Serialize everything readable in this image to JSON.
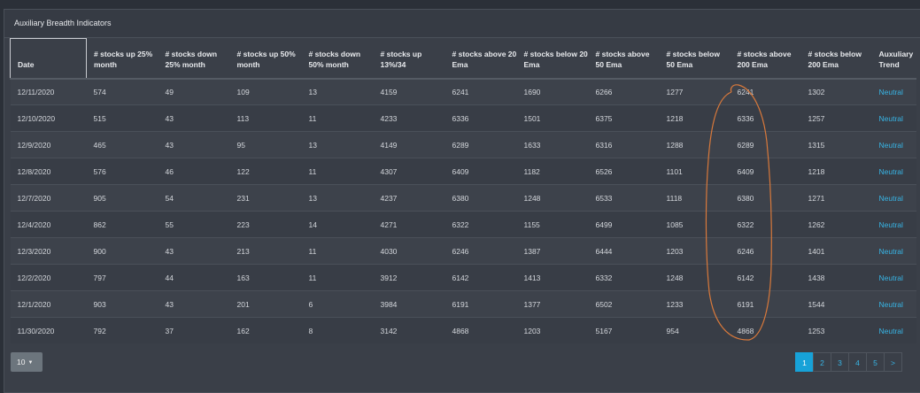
{
  "panel": {
    "title": "Auxiliary Breadth Indicators"
  },
  "table": {
    "headers": [
      "Date",
      "# stocks up 25% month",
      "# stocks down 25% month",
      "# stocks up 50% month",
      "# stocks down 50% month",
      "# stocks up 13%/34",
      "# stocks above 20 Ema",
      "# stocks below 20 Ema",
      "# stocks above 50 Ema",
      "# stocks below 50 Ema",
      "# stocks above 200 Ema",
      "# stocks below 200 Ema",
      "Auxuliary Trend"
    ],
    "rows": [
      [
        "12/11/2020",
        "574",
        "49",
        "109",
        "13",
        "4159",
        "6241",
        "1690",
        "6266",
        "1277",
        "6241",
        "1302",
        "Neutral"
      ],
      [
        "12/10/2020",
        "515",
        "43",
        "113",
        "11",
        "4233",
        "6336",
        "1501",
        "6375",
        "1218",
        "6336",
        "1257",
        "Neutral"
      ],
      [
        "12/9/2020",
        "465",
        "43",
        "95",
        "13",
        "4149",
        "6289",
        "1633",
        "6316",
        "1288",
        "6289",
        "1315",
        "Neutral"
      ],
      [
        "12/8/2020",
        "576",
        "46",
        "122",
        "11",
        "4307",
        "6409",
        "1182",
        "6526",
        "1101",
        "6409",
        "1218",
        "Neutral"
      ],
      [
        "12/7/2020",
        "905",
        "54",
        "231",
        "13",
        "4237",
        "6380",
        "1248",
        "6533",
        "1118",
        "6380",
        "1271",
        "Neutral"
      ],
      [
        "12/4/2020",
        "862",
        "55",
        "223",
        "14",
        "4271",
        "6322",
        "1155",
        "6499",
        "1085",
        "6322",
        "1262",
        "Neutral"
      ],
      [
        "12/3/2020",
        "900",
        "43",
        "213",
        "11",
        "4030",
        "6246",
        "1387",
        "6444",
        "1203",
        "6246",
        "1401",
        "Neutral"
      ],
      [
        "12/2/2020",
        "797",
        "44",
        "163",
        "11",
        "3912",
        "6142",
        "1413",
        "6332",
        "1248",
        "6142",
        "1438",
        "Neutral"
      ],
      [
        "12/1/2020",
        "903",
        "43",
        "201",
        "6",
        "3984",
        "6191",
        "1377",
        "6502",
        "1233",
        "6191",
        "1544",
        "Neutral"
      ],
      [
        "11/30/2020",
        "792",
        "37",
        "162",
        "8",
        "3142",
        "4868",
        "1203",
        "5167",
        "954",
        "4868",
        "1253",
        "Neutral"
      ]
    ]
  },
  "pagination": {
    "page_size": "10",
    "pages": [
      "1",
      "2",
      "3",
      "4",
      "5",
      ">"
    ],
    "active_page": "1"
  },
  "colors": {
    "accent": "#17a2d8",
    "trend_text": "#37b5e6",
    "annotation": "#d9793b"
  },
  "icons": {
    "page_size_caret": "caret-down-icon"
  }
}
